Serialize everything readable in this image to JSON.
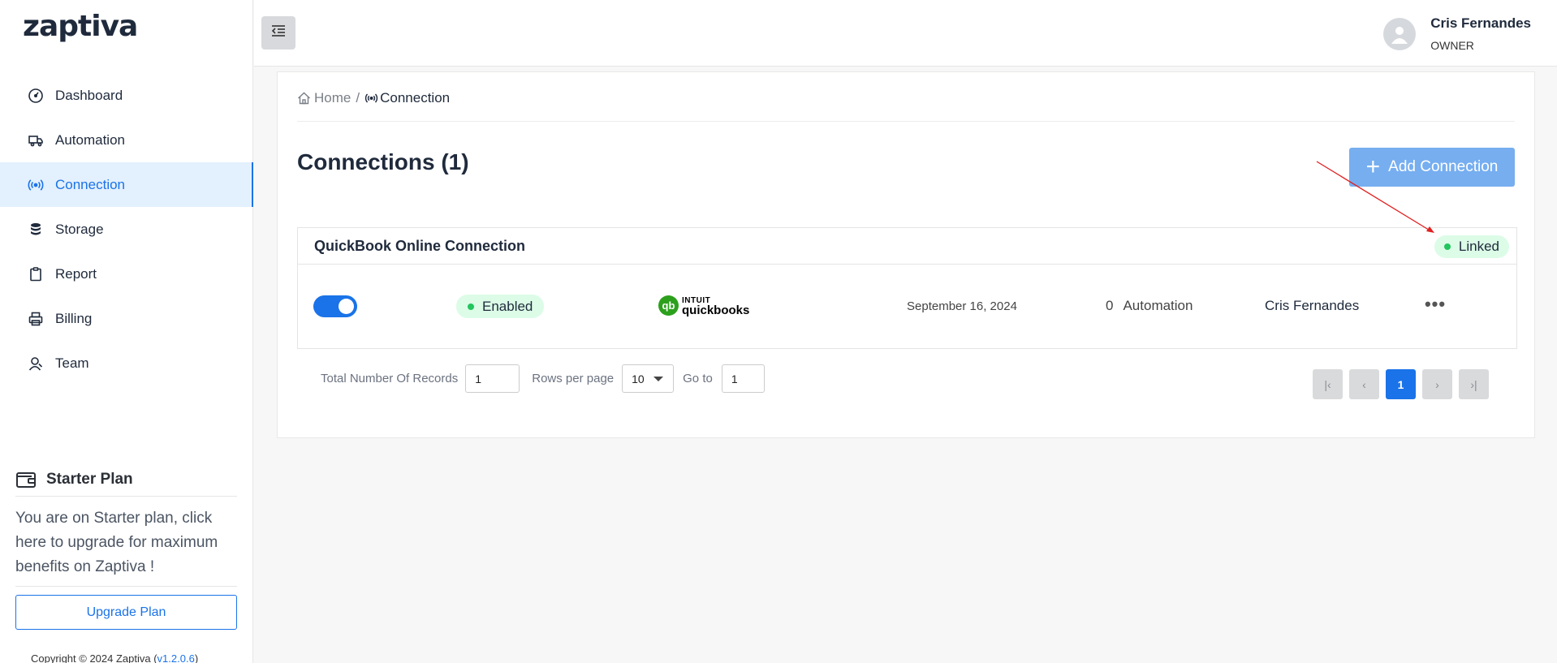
{
  "brand": {
    "logo_text": "zaptiva",
    "accent_color": "#1a73e8"
  },
  "sidebar": {
    "items": [
      {
        "label": "Dashboard",
        "icon": "gauge-icon"
      },
      {
        "label": "Automation",
        "icon": "truck-icon"
      },
      {
        "label": "Connection",
        "icon": "broadcast-icon",
        "active": true
      },
      {
        "label": "Storage",
        "icon": "database-icon"
      },
      {
        "label": "Report",
        "icon": "clipboard-icon"
      },
      {
        "label": "Billing",
        "icon": "printer-icon"
      },
      {
        "label": "Team",
        "icon": "user-icon"
      }
    ],
    "plan": {
      "title": "Starter Plan",
      "description": "You are on Starter plan, click here to upgrade for maximum benefits on Zaptiva !",
      "upgrade_label": "Upgrade Plan"
    },
    "copyright": {
      "text": "Copyright © 2024 Zaptiva (",
      "version": "v1.2.0.6",
      "suffix": ")"
    }
  },
  "topbar": {
    "user": {
      "name": "Cris Fernandes",
      "role": "OWNER"
    }
  },
  "breadcrumb": {
    "home": "Home",
    "separator": "/",
    "current": "Connection"
  },
  "main": {
    "title": "Connections (1)",
    "add_button_label": "Add Connection",
    "connection": {
      "name": "QuickBook Online Connection",
      "link_status": "Linked",
      "status": "Enabled",
      "toggle_on": true,
      "provider_logo": {
        "top": "INTUIT",
        "bottom": "quickbooks",
        "mark": "qb"
      },
      "date": "September 16, 2024",
      "automation_count": "0",
      "automation_label": "Automation",
      "owner": "Cris Fernandes",
      "menu_glyph": "•••"
    },
    "pagination": {
      "total_label": "Total Number Of Records",
      "total_value": "1",
      "rows_label": "Rows per page",
      "rows_value": "10",
      "goto_label": "Go to",
      "goto_value": "1",
      "current_page": "1",
      "first_glyph": "|‹",
      "prev_glyph": "‹",
      "next_glyph": "›",
      "last_glyph": "›|"
    }
  },
  "colors": {
    "sidebar_active_bg": "#e3f0fd",
    "primary": "#1a73e8",
    "add_button": "#76aef0",
    "status_bg": "#dcfce7",
    "status_dot": "#22c55e",
    "annotation_arrow": "#e02020"
  }
}
